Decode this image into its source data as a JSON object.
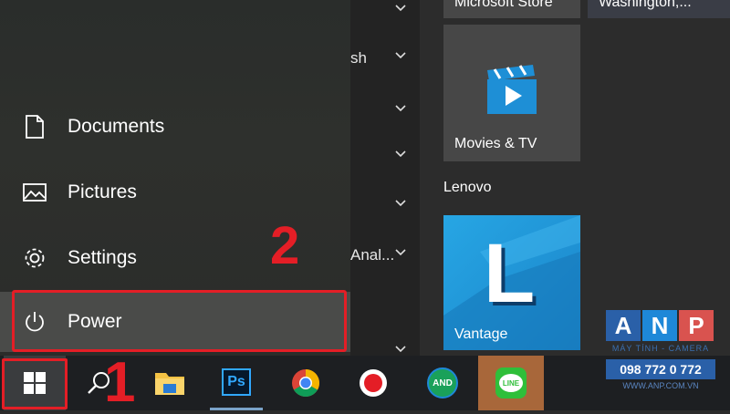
{
  "start_menu": {
    "rail_items": [
      {
        "label": "Documents",
        "icon": "document-icon"
      },
      {
        "label": "Pictures",
        "icon": "pictures-icon"
      },
      {
        "label": "Settings",
        "icon": "gear-icon"
      },
      {
        "label": "Power",
        "icon": "power-icon"
      }
    ]
  },
  "app_list": {
    "fragments": [
      "sh",
      "Anal..."
    ]
  },
  "tiles": {
    "top_left_label": "Microsoft Store",
    "top_right_label": "Washington,...",
    "movies_label": "Movies & TV",
    "group_title": "Lenovo",
    "vantage_label": "Vantage",
    "vantage_letter": "L"
  },
  "annotations": {
    "step1": "1",
    "step2": "2"
  },
  "taskbar": {
    "apps": [
      "start-icon",
      "search-icon",
      "file-explorer-icon",
      "photoshop-icon",
      "chrome-icon",
      "recorder-icon",
      "and-app-icon",
      "line-icon"
    ],
    "photoshop_text": "Ps",
    "and_text": "AND",
    "line_text": "LINE"
  },
  "watermark": {
    "letters": [
      "A",
      "N",
      "P"
    ],
    "tagline": "MÁY TÍNH - CAMERA",
    "phone": "098 772 0 772",
    "site": "WWW.ANP.COM.VN"
  },
  "colors": {
    "accent_red": "#e41e26",
    "tile_blue": "#1e8fd6",
    "taskbar": "#1d1f22"
  }
}
